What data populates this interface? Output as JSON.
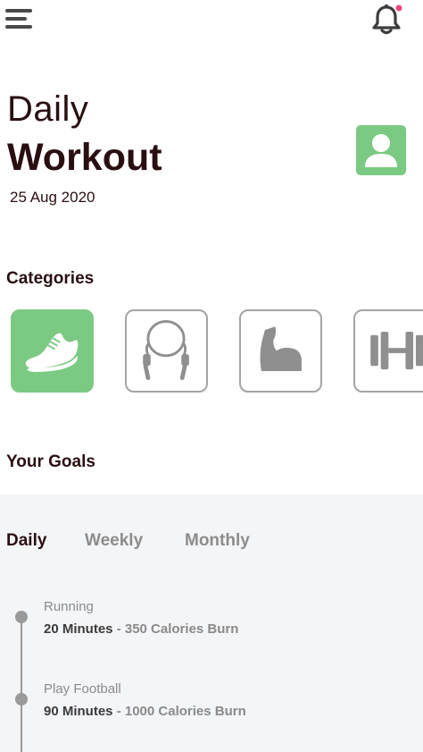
{
  "header": {
    "menu_icon": "hamburger-menu-icon",
    "bell_icon": "bell-icon",
    "notification_color": "#f0457a"
  },
  "hero": {
    "title_line1": "Daily",
    "title_line2": "Workout",
    "date": "25 Aug 2020",
    "avatar_icon": "user-avatar-icon",
    "accent_color": "#7bca83"
  },
  "categories": {
    "title": "Categories",
    "items": [
      {
        "icon": "running-shoe-icon",
        "active": true
      },
      {
        "icon": "jump-rope-icon",
        "active": false
      },
      {
        "icon": "flexed-arm-icon",
        "active": false
      },
      {
        "icon": "dumbbell-icon",
        "active": false
      }
    ]
  },
  "goals": {
    "title": "Your Goals",
    "tabs": [
      {
        "label": "Daily",
        "active": true
      },
      {
        "label": "Weekly",
        "active": false
      },
      {
        "label": "Monthly",
        "active": false
      }
    ],
    "items": [
      {
        "name": "Running",
        "duration": "20 Minutes",
        "calories": " - 350 Calories Burn"
      },
      {
        "name": "Play Football",
        "duration": "90 Minutes",
        "calories": " - 1000 Calories Burn"
      }
    ]
  }
}
